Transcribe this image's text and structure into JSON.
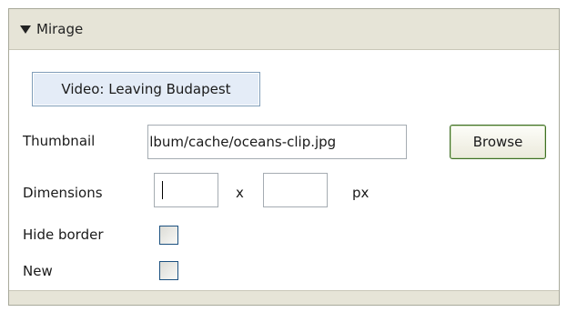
{
  "panel": {
    "title": "Mirage",
    "video_button_label": "Video: Leaving Budapest"
  },
  "thumbnail": {
    "label": "Thumbnail",
    "value": "album/cache/oceans-clip.jpg",
    "browse_label": "Browse"
  },
  "dimensions": {
    "label": "Dimensions",
    "width_value": "",
    "height_value": "",
    "separator": "x",
    "unit": "px"
  },
  "hide_border": {
    "label": "Hide border",
    "checked": false
  },
  "new": {
    "label": "New",
    "checked": false
  },
  "colors": {
    "panel_background": "#e6e4d7",
    "content_background": "#ffffff",
    "browse_border": "#3f6e24",
    "input_border": "#a5acb2",
    "checkbox_border": "#1c5180"
  }
}
